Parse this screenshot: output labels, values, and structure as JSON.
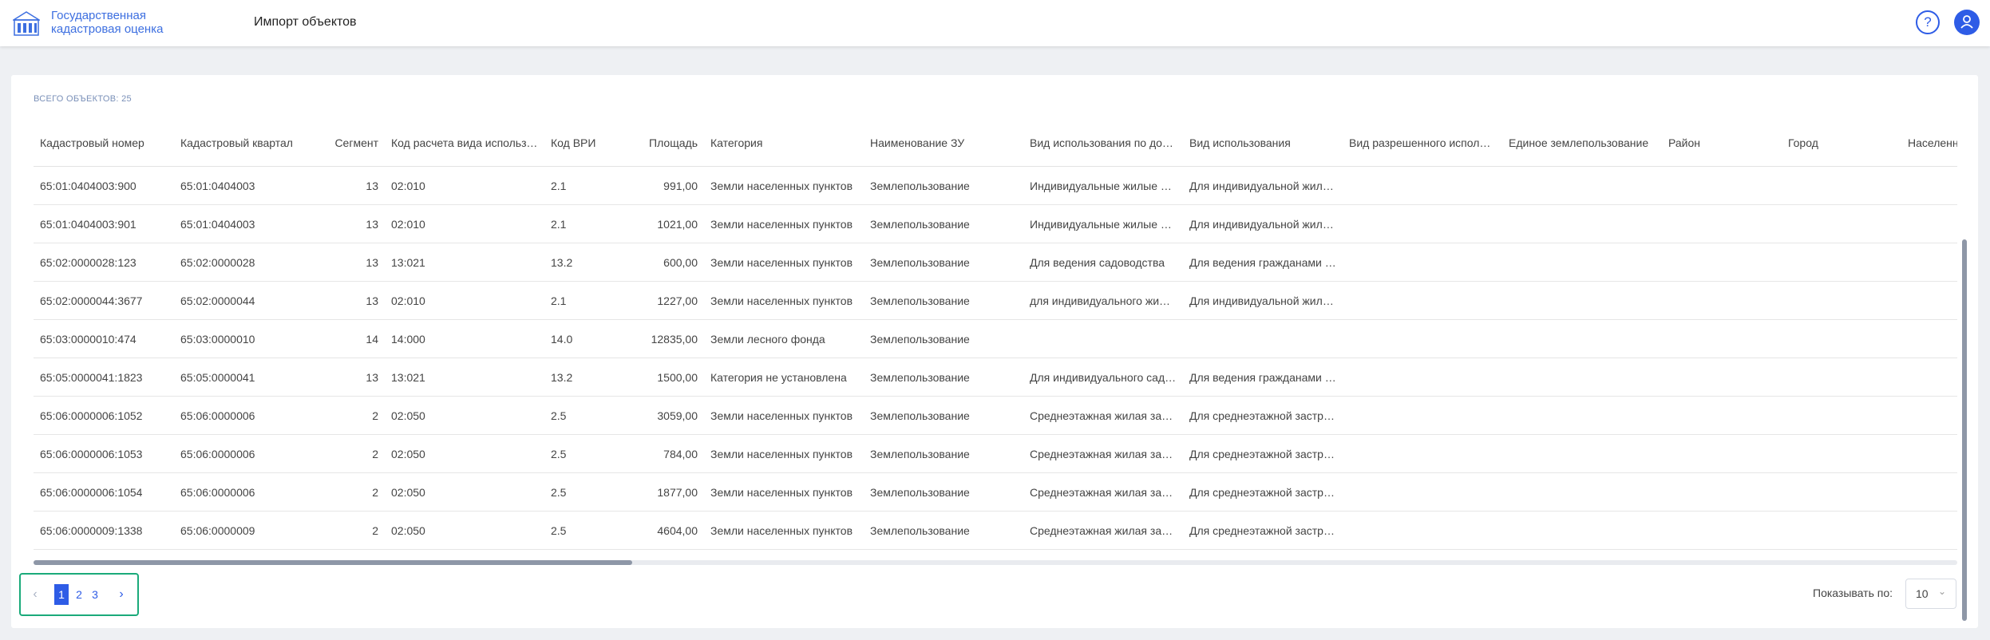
{
  "app": {
    "brand_line1": "Государственная",
    "brand_line2": "кадастровая оценка",
    "page_title": "Импорт объектов",
    "help_label": "?"
  },
  "icons": {
    "logo": "building-logo-icon",
    "help": "help-icon",
    "user": "user-icon",
    "prev": "chevron-left-icon",
    "next": "chevron-right-icon",
    "select": "chevron-down-icon"
  },
  "colors": {
    "accent": "#2e5ce6",
    "pager_border": "#1aaa7a"
  },
  "table": {
    "total_label": "ВСЕГО ОБЪЕКТОВ: 25",
    "columns": [
      "Кадастровый номер",
      "Кадастровый квартал",
      "Сегмент",
      "Код расчета вида использования",
      "Код ВРИ",
      "Площадь",
      "Категория",
      "Наименование ЗУ",
      "Вид использования по документу",
      "Вид использования",
      "Вид разрешенного использования",
      "Единое землепользование",
      "Район",
      "Город",
      "Населенный пункт"
    ],
    "rows": [
      [
        "65:01:0404003:900",
        "65:01:0404003",
        "13",
        "02:010",
        "2.1",
        "991,00",
        "Земли населенных пунктов",
        "Землепользование",
        "Индивидуальные жилые дома",
        "Для индивидуальной жилой застройки",
        "",
        "",
        "",
        "",
        ""
      ],
      [
        "65:01:0404003:901",
        "65:01:0404003",
        "13",
        "02:010",
        "2.1",
        "1021,00",
        "Земли населенных пунктов",
        "Землепользование",
        "Индивидуальные жилые дома",
        "Для индивидуальной жилой застройки",
        "",
        "",
        "",
        "",
        ""
      ],
      [
        "65:02:0000028:123",
        "65:02:0000028",
        "13",
        "13:021",
        "13.2",
        "600,00",
        "Земли населенных пунктов",
        "Землепользование",
        "Для ведения садоводства",
        "Для ведения гражданами садоводства",
        "",
        "",
        "",
        "",
        ""
      ],
      [
        "65:02:0000044:3677",
        "65:02:0000044",
        "13",
        "02:010",
        "2.1",
        "1227,00",
        "Земли населенных пунктов",
        "Землепользование",
        "для индивидуального жилищного строительства",
        "Для индивидуальной жилой застройки",
        "",
        "",
        "",
        "",
        ""
      ],
      [
        "65:03:0000010:474",
        "65:03:0000010",
        "14",
        "14:000",
        "14.0",
        "12835,00",
        "Земли лесного фонда",
        "Землепользование",
        "",
        "",
        "",
        "",
        "",
        "",
        ""
      ],
      [
        "65:05:0000041:1823",
        "65:05:0000041",
        "13",
        "13:021",
        "13.2",
        "1500,00",
        "Категория не установлена",
        "Землепользование",
        "Для индивидуального садоводства",
        "Для ведения гражданами садоводства",
        "",
        "",
        "",
        "",
        ""
      ],
      [
        "65:06:0000006:1052",
        "65:06:0000006",
        "2",
        "02:050",
        "2.5",
        "3059,00",
        "Земли населенных пунктов",
        "Землепользование",
        "Среднеэтажная жилая застройка",
        "Для среднеэтажной застройки",
        "",
        "",
        "",
        "",
        ""
      ],
      [
        "65:06:0000006:1053",
        "65:06:0000006",
        "2",
        "02:050",
        "2.5",
        "784,00",
        "Земли населенных пунктов",
        "Землепользование",
        "Среднеэтажная жилая застройка",
        "Для среднеэтажной застройки",
        "",
        "",
        "",
        "",
        ""
      ],
      [
        "65:06:0000006:1054",
        "65:06:0000006",
        "2",
        "02:050",
        "2.5",
        "1877,00",
        "Земли населенных пунктов",
        "Землепользование",
        "Среднеэтажная жилая застройка",
        "Для среднеэтажной застройки",
        "",
        "",
        "",
        "",
        ""
      ],
      [
        "65:06:0000009:1338",
        "65:06:0000009",
        "2",
        "02:050",
        "2.5",
        "4604,00",
        "Земли населенных пунктов",
        "Землепользование",
        "Среднеэтажная жилая застройка",
        "Для среднеэтажной застройки",
        "",
        "",
        "",
        "",
        ""
      ]
    ]
  },
  "pagination": {
    "pages": [
      "1",
      "2",
      "3"
    ],
    "current": "1",
    "page_size_label": "Показывать по:",
    "page_size": "10"
  }
}
